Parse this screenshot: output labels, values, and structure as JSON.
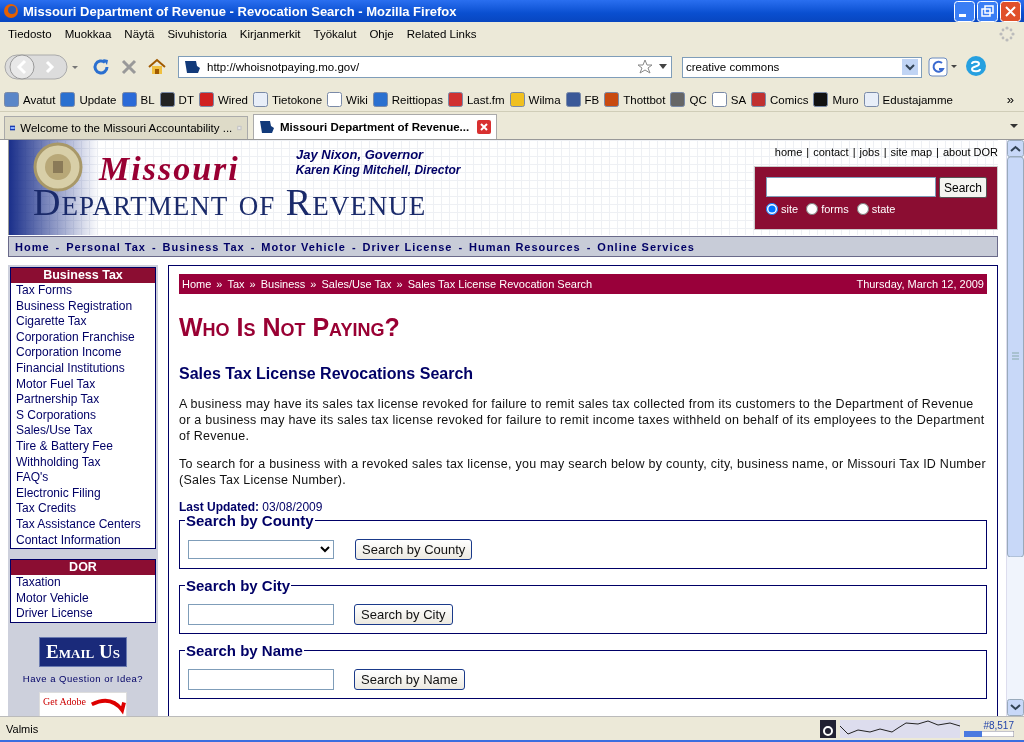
{
  "window": {
    "title": "Missouri Department of Revenue - Revocation Search - Mozilla Firefox"
  },
  "menu": [
    "Tiedosto",
    "Muokkaa",
    "Näytä",
    "Sivuhistoria",
    "Kirjanmerkit",
    "Työkalut",
    "Ohje",
    "Related Links"
  ],
  "toolbar": {
    "url": "http://whoisnotpaying.mo.gov/",
    "search_value": "creative commons"
  },
  "bookmarks": {
    "items": [
      "Avatut",
      "Update",
      "BL",
      "DT",
      "Wired",
      "Tietokone",
      "Wiki",
      "Reittiopas",
      "Last.fm",
      "Wilma",
      "FB",
      "Thottbot",
      "QC",
      "SA",
      "Comics",
      "Muro",
      "Edustajamme"
    ],
    "overflow": "»"
  },
  "tabs": [
    {
      "label": "Welcome to the Missouri Accountability ...",
      "selected": false
    },
    {
      "label": "Missouri Department of Revenue...",
      "selected": true
    }
  ],
  "page": {
    "header": {
      "governor": "Jay Nixon, Governor",
      "director": "Karen King Mitchell, Director",
      "logo_script": "Missouri",
      "logo_title": "Department of Revenue",
      "top_links": [
        "home",
        "contact",
        "jobs",
        "site map",
        "about DOR"
      ],
      "link_separator": "|",
      "search_button": "Search",
      "scopes": [
        {
          "label": "site",
          "selected": true
        },
        {
          "label": "forms",
          "selected": false
        },
        {
          "label": "state",
          "selected": false
        }
      ]
    },
    "nav": {
      "items": [
        "Home",
        "Personal Tax",
        "Business Tax",
        "Motor Vehicle",
        "Driver License",
        "Human Resources",
        "Online Services"
      ],
      "separator": "-"
    },
    "sidebar": {
      "sections": [
        {
          "title": "Business Tax",
          "items": [
            "Tax Forms",
            "Business Registration",
            "Cigarette Tax",
            "Corporation Franchise",
            "Corporation Income",
            "Financial Institutions",
            "Motor Fuel Tax",
            "Partnership Tax",
            "S Corporations",
            "Sales/Use Tax",
            "Tire & Battery Fee",
            "Withholding Tax",
            "FAQ's",
            "Electronic Filing",
            "Tax Credits",
            "Tax Assistance Centers",
            "Contact Information"
          ]
        },
        {
          "title": "DOR",
          "items": [
            "Taxation",
            "Motor Vehicle",
            "Driver License"
          ]
        }
      ],
      "email_button": "Email Us",
      "email_caption": "Have a Question or Idea?",
      "adobe_badge": "Get Adobe"
    },
    "main": {
      "breadcrumb": [
        "Home",
        "Tax",
        "Business",
        "Sales/Use Tax",
        "Sales Tax License Revocation Search"
      ],
      "breadcrumb_separator": "»",
      "date": "Thursday, March 12, 2009",
      "heading": "Who Is Not Paying?",
      "subheading": "Sales Tax License Revocations Search",
      "paragraphs": [
        "A business may have its sales tax license revoked for failure to remit sales tax collected from its customers to the Department of Revenue or a business may have its sales tax license revoked for failure to remit income taxes withheld on behalf of its employees to the Department of Revenue.",
        "To search for a business with a revoked sales tax license, you may search below by county, city, business name, or Missouri Tax ID Number (Sales Tax License Number)."
      ],
      "last_updated": "**Last Updated:** 03/08/2009",
      "search_groups": [
        {
          "legend": "Search by County",
          "kind": "select",
          "button": "Search by County"
        },
        {
          "legend": "Search by City",
          "kind": "text",
          "button": "Search by City"
        },
        {
          "legend": "Search by Name",
          "kind": "text",
          "button": "Search by Name"
        }
      ]
    }
  },
  "status_bar": {
    "text": "Valmis",
    "counter": "#8,517"
  }
}
